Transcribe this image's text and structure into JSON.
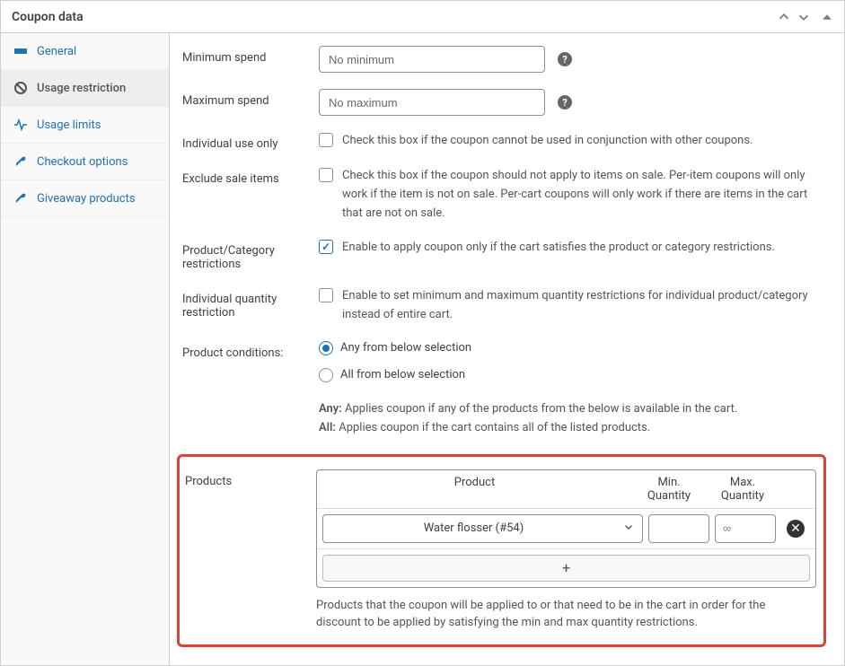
{
  "header": {
    "title": "Coupon data"
  },
  "sidebar": {
    "items": [
      {
        "label": "General",
        "icon": "ticket"
      },
      {
        "label": "Usage restriction",
        "icon": "ban"
      },
      {
        "label": "Usage limits",
        "icon": "pulse"
      },
      {
        "label": "Checkout options",
        "icon": "wrench"
      },
      {
        "label": "Giveaway products",
        "icon": "wrench"
      }
    ]
  },
  "form": {
    "min_spend": {
      "label": "Minimum spend",
      "placeholder": "No minimum"
    },
    "max_spend": {
      "label": "Maximum spend",
      "placeholder": "No maximum"
    },
    "individual_use": {
      "label": "Individual use only",
      "text": "Check this box if the coupon cannot be used in conjunction with other coupons."
    },
    "exclude_sale": {
      "label": "Exclude sale items",
      "text": "Check this box if the coupon should not apply to items on sale. Per-item coupons will only work if the item is not on sale. Per-cart coupons will only work if there are items in the cart that are not on sale."
    },
    "prod_cat_restrictions": {
      "label": "Product/Category restrictions",
      "text": "Enable to apply coupon only if the cart satisfies the product or category restrictions."
    },
    "individual_qty": {
      "label": "Individual quantity restriction",
      "text": "Enable to set minimum and maximum quantity restrictions for individual product/category instead of entire cart."
    },
    "product_conditions": {
      "label": "Product conditions:",
      "any": "Any from below selection",
      "all": "All from below selection",
      "help_any_label": "Any:",
      "help_any_text": " Applies coupon if any of the products from the below is available in the cart.",
      "help_all_label": "All:",
      "help_all_text": " Applies coupon if the cart contains all of the listed products."
    },
    "products": {
      "label": "Products",
      "col_product": "Product",
      "col_min": "Min. Quantity",
      "col_max": "Max. Quantity",
      "selected": "Water flosser (#54)",
      "min_placeholder": "",
      "max_placeholder": "∞",
      "add": "+",
      "description": "Products that the coupon will be applied to or that need to be in the cart in order for the discount to be applied by satisfying the min and max quantity restrictions."
    }
  }
}
